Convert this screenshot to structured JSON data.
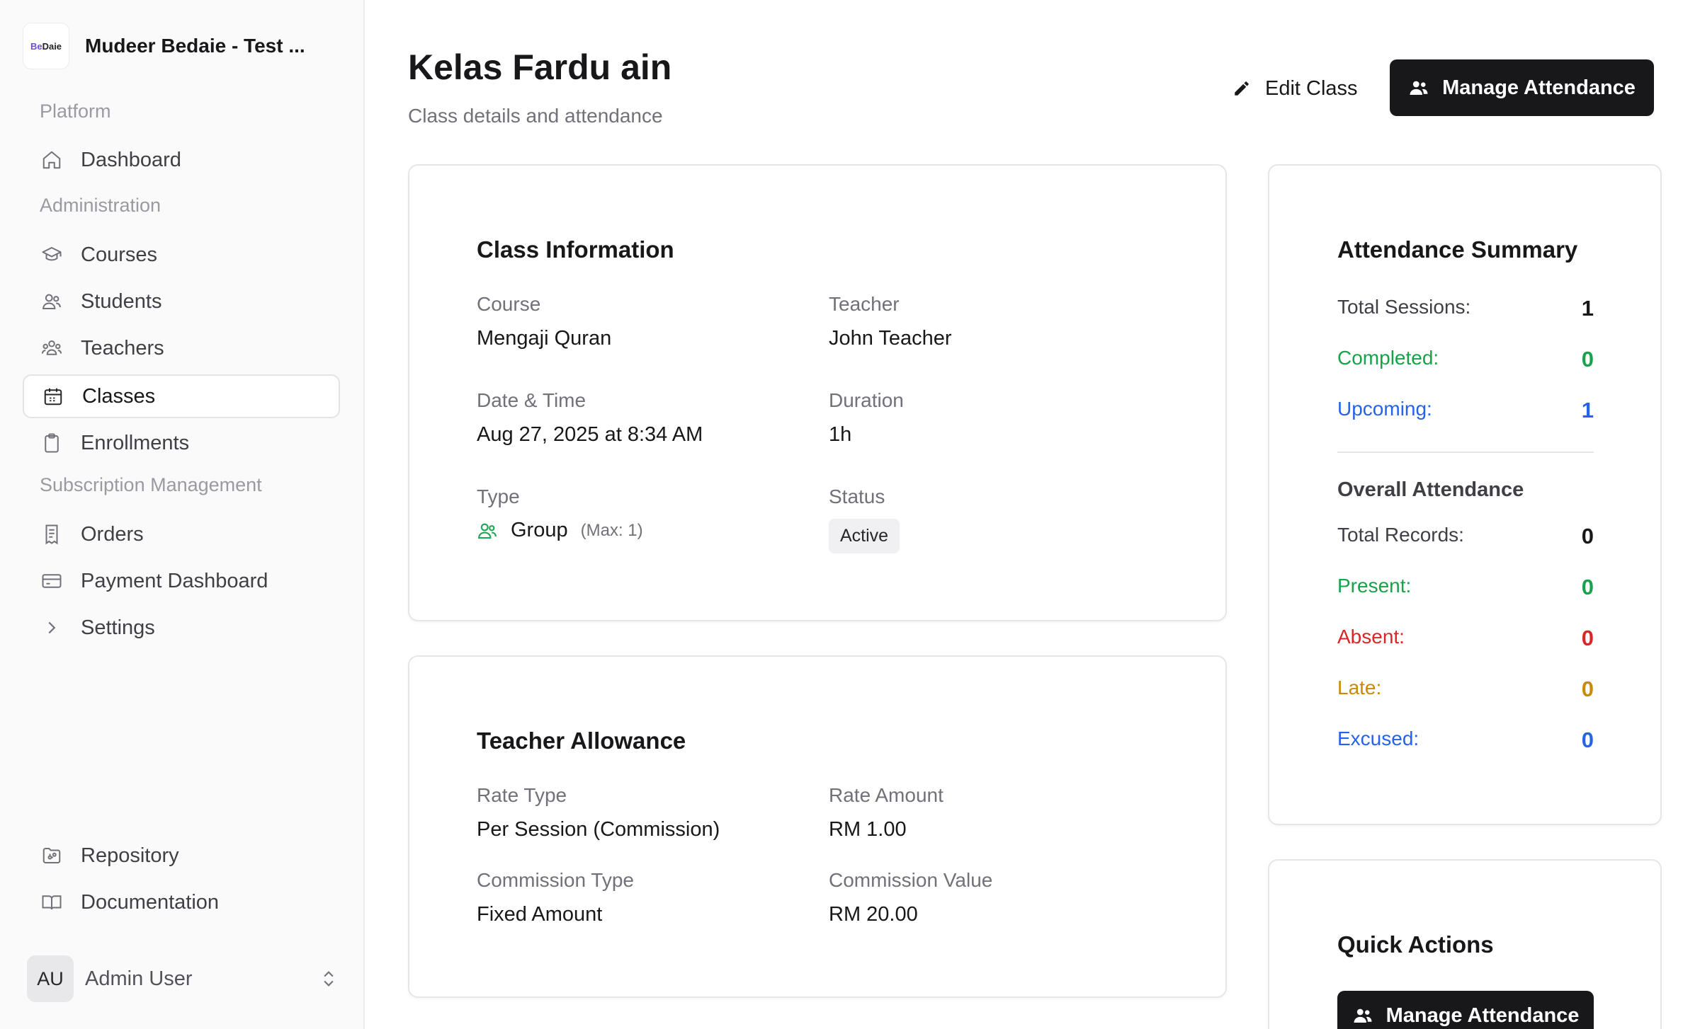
{
  "brand": {
    "logo_text_a": "Be",
    "logo_text_b": "Daie",
    "name": "Mudeer Bedaie - Test ..."
  },
  "sidebar": {
    "groups": [
      "Platform",
      "Administration",
      "Subscription Management"
    ],
    "items": [
      {
        "label": "Dashboard",
        "icon": "home-icon"
      },
      {
        "label": "Courses",
        "icon": "graduation-cap-icon"
      },
      {
        "label": "Students",
        "icon": "users-icon"
      },
      {
        "label": "Teachers",
        "icon": "users-group-icon"
      },
      {
        "label": "Classes",
        "icon": "calendar-icon",
        "active": true
      },
      {
        "label": "Enrollments",
        "icon": "clipboard-icon"
      },
      {
        "label": "Orders",
        "icon": "receipt-icon"
      },
      {
        "label": "Payment Dashboard",
        "icon": "credit-card-icon"
      },
      {
        "label": "Settings",
        "icon": "chevron-right-icon"
      },
      {
        "label": "Repository",
        "icon": "folder-git-icon"
      },
      {
        "label": "Documentation",
        "icon": "book-open-icon"
      }
    ],
    "user": {
      "initials": "AU",
      "name": "Admin User"
    }
  },
  "header": {
    "title": "Kelas Fardu ain",
    "subtitle": "Class details and attendance",
    "edit_label": "Edit Class",
    "manage_label": "Manage Attendance"
  },
  "class_info": {
    "title": "Class Information",
    "course_label": "Course",
    "course_value": "Mengaji Quran",
    "teacher_label": "Teacher",
    "teacher_value": "John Teacher",
    "datetime_label": "Date & Time",
    "datetime_value": "Aug 27, 2025 at 8:34 AM",
    "duration_label": "Duration",
    "duration_value": "1h",
    "type_label": "Type",
    "type_value": "Group",
    "type_max": "(Max: 1)",
    "status_label": "Status",
    "status_value": "Active"
  },
  "allowance": {
    "title": "Teacher Allowance",
    "rate_type_label": "Rate Type",
    "rate_type_value": "Per Session (Commission)",
    "rate_amount_label": "Rate Amount",
    "rate_amount_value": "RM 1.00",
    "commission_type_label": "Commission Type",
    "commission_type_value": "Fixed Amount",
    "commission_value_label": "Commission Value",
    "commission_value_value": "RM 20.00"
  },
  "summary": {
    "title": "Attendance Summary",
    "sessions": [
      {
        "label": "Total Sessions:",
        "value": "1",
        "color": "#3f3f46",
        "vcolor": "#18181b"
      },
      {
        "label": "Completed:",
        "value": "0",
        "color": "#16a34a",
        "vcolor": "#16a34a"
      },
      {
        "label": "Upcoming:",
        "value": "1",
        "color": "#2563eb",
        "vcolor": "#2563eb"
      }
    ],
    "overall_title": "Overall Attendance",
    "records": [
      {
        "label": "Total Records:",
        "value": "0",
        "color": "#3f3f46",
        "vcolor": "#18181b"
      },
      {
        "label": "Present:",
        "value": "0",
        "color": "#16a34a",
        "vcolor": "#16a34a"
      },
      {
        "label": "Absent:",
        "value": "0",
        "color": "#dc2626",
        "vcolor": "#dc2626"
      },
      {
        "label": "Late:",
        "value": "0",
        "color": "#ca8a04",
        "vcolor": "#ca8a04"
      },
      {
        "label": "Excused:",
        "value": "0",
        "color": "#2563eb",
        "vcolor": "#2563eb"
      }
    ]
  },
  "quick_actions": {
    "title": "Quick Actions",
    "manage_label": "Manage Attendance"
  }
}
